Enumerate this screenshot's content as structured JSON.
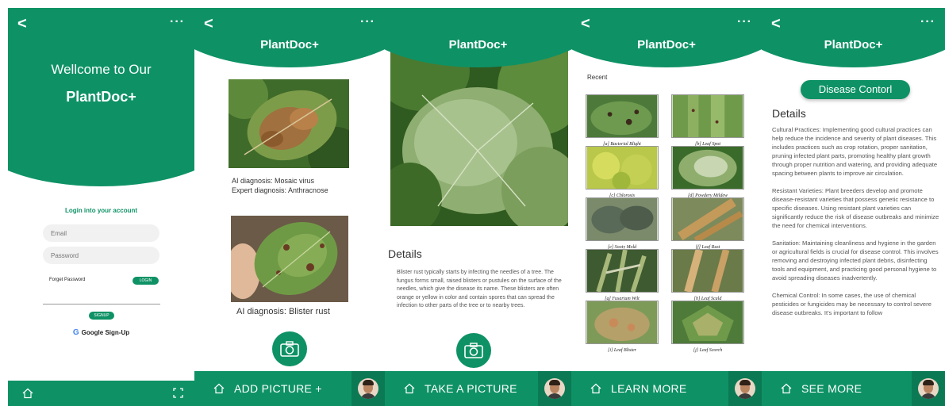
{
  "brand": "PlantDoc+",
  "colors": {
    "primary": "#0e9265",
    "avatar_bg": "#0b7a54"
  },
  "icons": {
    "back": "<",
    "menu": "···",
    "home": "home-icon",
    "camera": "camera-icon",
    "expand": "expand-icon"
  },
  "login": {
    "welcome": "Wellcome to Our",
    "brand": "PlantDoc+",
    "title": "Login into your account",
    "email_placeholder": "Email",
    "password_placeholder": "Password",
    "forgot": "Forget Password",
    "login_btn": "LOGIN",
    "signup_btn": "SIGNUP",
    "google_g": "G",
    "google": "Google Sign-Up"
  },
  "results": {
    "item1_line1": "AI diagnosis: Mosaic virus",
    "item1_line2": "Expert diagnosis: Anthracnose",
    "item2": "AI diagnosis: Blister rust",
    "bar_label": "ADD PICTURE +"
  },
  "details": {
    "title": "Details",
    "text": "Blister rust typically starts by infecting the needles of a tree. The fungus forms small, raised blisters or pustules on the surface of the needles, which give the disease its name. These blisters are often orange or yellow in color and contain spores that can spread the infection to other parts of the tree or to nearby trees.",
    "bar_label": "TAKE A PICTURE"
  },
  "learn": {
    "recent": "Recent",
    "items": [
      "[a] Bacterial Blight",
      "[b] Leaf Spot",
      "[c] Chlorosis",
      "[d] Powdery Mildew",
      "[e] Sooty Mold",
      "[f] Leaf Rust",
      "[g] Fusarium Wilt",
      "[h] Leaf Scald",
      "[i] Leaf Blister",
      "[j] Leaf Scorch"
    ],
    "bar_label": "LEARN MORE"
  },
  "control": {
    "pill": "Disease Contorl",
    "title": "Details",
    "p1": "Cultural Practices: Implementing good cultural practices can help reduce the incidence and severity of plant diseases. This includes practices such as crop rotation, proper sanitation, pruning infected plant parts, promoting healthy plant growth through proper nutrition and watering, and providing adequate spacing between plants to improve air circulation.",
    "p2": "Resistant Varieties: Plant breeders develop and promote disease-resistant varieties that possess genetic resistance to specific diseases. Using resistant plant varieties can significantly reduce the risk of disease outbreaks and minimize the need for chemical interventions.",
    "p3": "Sanitation: Maintaining cleanliness and hygiene in the garden or agricultural fields is crucial for disease control. This involves removing and destroying infected plant debris, disinfecting tools and equipment, and practicing good personal hygiene to avoid spreading diseases inadvertently.",
    "p4": "Chemical Control: In some cases, the use of chemical pesticides or fungicides may be necessary to control severe disease outbreaks. It's important to follow",
    "bar_label": "SEE MORE"
  }
}
